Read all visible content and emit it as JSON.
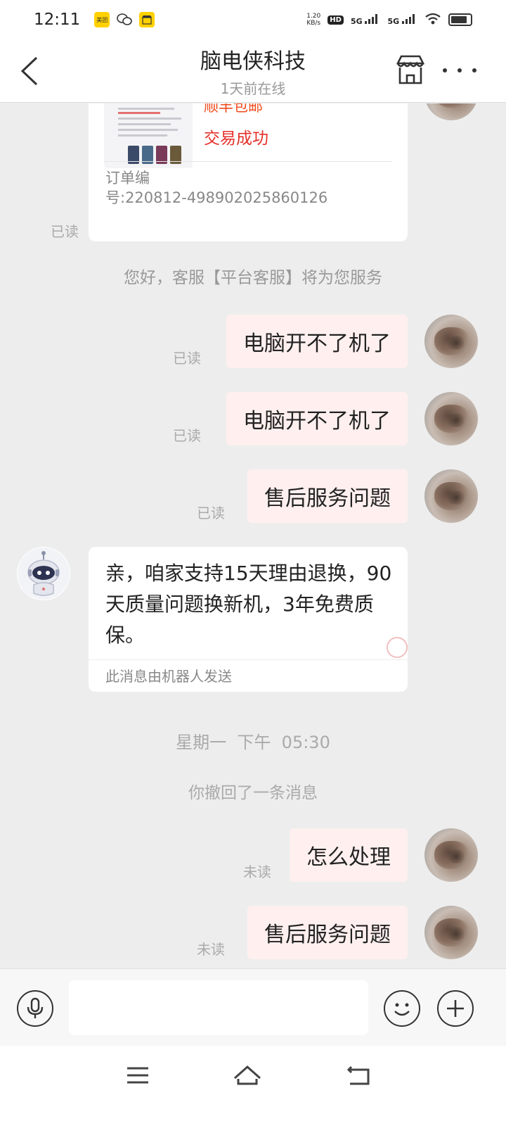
{
  "status_bar": {
    "time": "12:11",
    "meituan": "美团",
    "speed_value": "1.20",
    "speed_unit": "KB/s",
    "hd": "HD",
    "sim1": "5G",
    "sim2": "5G",
    "battery_level": 0.85
  },
  "header": {
    "title": "脑电侠科技",
    "subtitle": "1天前在线"
  },
  "order": {
    "shipping": "顺丰包邮",
    "status": "交易成功",
    "order_no_label": "订单编",
    "order_no_value": "号:220812-498902025860126",
    "read": "已读"
  },
  "system_messages": {
    "service_notice": "您好，客服【平台客服】将为您服务",
    "timestamp": "星期一  下午  05:30",
    "recalled": "你撤回了一条消息"
  },
  "messages": [
    {
      "text": "电脑开不了机了",
      "status": "已读"
    },
    {
      "text": "电脑开不了机了",
      "status": "已读"
    },
    {
      "text": "售后服务问题",
      "status": "已读"
    },
    {
      "text": "怎么处理",
      "status": "未读"
    },
    {
      "text": "售后服务问题",
      "status": "未读"
    }
  ],
  "bot_message": {
    "text": "亲，咱家支持15天理由退换，90天质量问题换新机，3年免费质保。",
    "footer": "此消息由机器人发送"
  },
  "input": {
    "placeholder": ""
  }
}
